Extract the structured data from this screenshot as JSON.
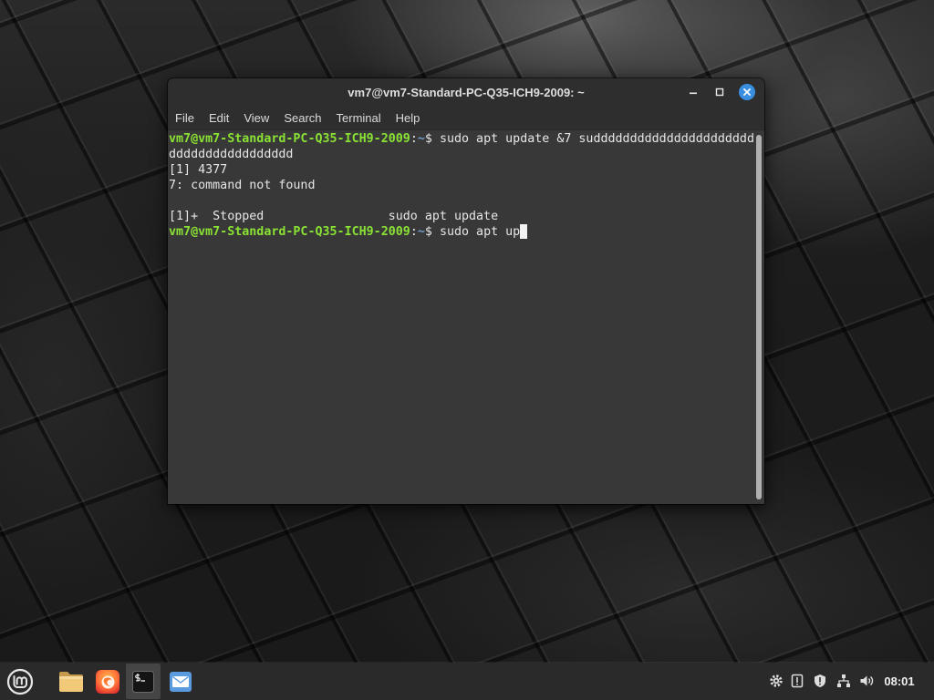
{
  "colors": {
    "prompt_user": "#8ae234",
    "prompt_cwd": "#729fcf",
    "term_bg": "#383838",
    "term_fg": "#e6e6e6",
    "chrome_bg": "#2e2e2e",
    "close_button": "#3a8ee0",
    "taskbar_bg": "#2a2a2a"
  },
  "window": {
    "title": "vm7@vm7-Standard-PC-Q35-ICH9-2009: ~",
    "controls": {
      "minimize": "minimize-icon",
      "maximize": "maximize-icon",
      "close": "close-icon"
    }
  },
  "menu": [
    "File",
    "Edit",
    "View",
    "Search",
    "Terminal",
    "Help"
  ],
  "terminal": {
    "lines": [
      {
        "user_host": "vm7@vm7-Standard-PC-Q35-ICH9-2009",
        "separator": ":",
        "cwd": "~",
        "prompt_symbol": "$ ",
        "command": "sudo apt update &7 sudddddddddddddddddddddd"
      },
      {
        "text": "ddddddddddddddddd"
      },
      {
        "text": "[1] 4377"
      },
      {
        "text": "7: command not found"
      },
      {
        "text": ""
      },
      {
        "text": "[1]+  Stopped                 sudo apt update"
      },
      {
        "user_host": "vm7@vm7-Standard-PC-Q35-ICH9-2009",
        "separator": ":",
        "cwd": "~",
        "prompt_symbol": "$ ",
        "command": "sudo apt up"
      }
    ]
  },
  "taskbar": {
    "menu_button": "linux-mint-logo-icon",
    "launchers": [
      {
        "icon": "folder-icon",
        "active": false
      },
      {
        "icon": "firefox-icon",
        "active": false
      },
      {
        "icon": "terminal-icon",
        "active": true
      },
      {
        "icon": "mail-icon",
        "active": false
      }
    ],
    "tray": [
      "settings-gear-icon",
      "alert-box-icon",
      "update-shield-icon",
      "network-icon",
      "volume-icon"
    ],
    "clock": "08:01"
  }
}
